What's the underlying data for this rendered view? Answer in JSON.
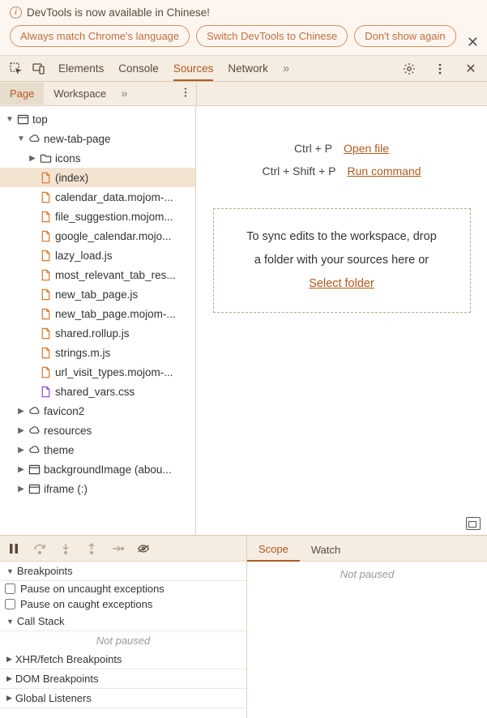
{
  "banner": {
    "title": "DevTools is now available in Chinese!",
    "buttons": [
      "Always match Chrome's language",
      "Switch DevTools to Chinese",
      "Don't show again"
    ]
  },
  "toolbar": {
    "tabs": [
      "Elements",
      "Console",
      "Sources",
      "Network"
    ],
    "active_tab": "Sources"
  },
  "subtabs": {
    "left": [
      "Page",
      "Workspace"
    ],
    "active": "Page"
  },
  "tree": {
    "top": "top",
    "origin": "new-tab-page",
    "folders_top": [
      "icons"
    ],
    "selected": "(index)",
    "files": [
      "calendar_data.mojom-...",
      "file_suggestion.mojom...",
      "google_calendar.mojo...",
      "lazy_load.js",
      "most_relevant_tab_res...",
      "new_tab_page.js",
      "new_tab_page.mojom-...",
      "shared.rollup.js",
      "strings.m.js",
      "url_visit_types.mojom-..."
    ],
    "css_file": "shared_vars.css",
    "subframes": [
      "favicon2",
      "resources",
      "theme"
    ],
    "frames": [
      "backgroundImage (abou...",
      "iframe (:)"
    ]
  },
  "shortcuts": {
    "open_file_key": "Ctrl + P",
    "open_file": "Open file",
    "run_cmd_key": "Ctrl + Shift + P",
    "run_cmd": "Run command"
  },
  "dropzone": {
    "line1": "To sync edits to the workspace, drop",
    "line2": "a folder with your sources here or",
    "link": "Select folder"
  },
  "debug_sections": {
    "breakpoints": "Breakpoints",
    "pause_uncaught": "Pause on uncaught exceptions",
    "pause_caught": "Pause on caught exceptions",
    "call_stack": "Call Stack",
    "not_paused": "Not paused",
    "xhr": "XHR/fetch Breakpoints",
    "dom": "DOM Breakpoints",
    "global": "Global Listeners"
  },
  "scope_tabs": {
    "scope": "Scope",
    "watch": "Watch",
    "not_paused": "Not paused"
  }
}
